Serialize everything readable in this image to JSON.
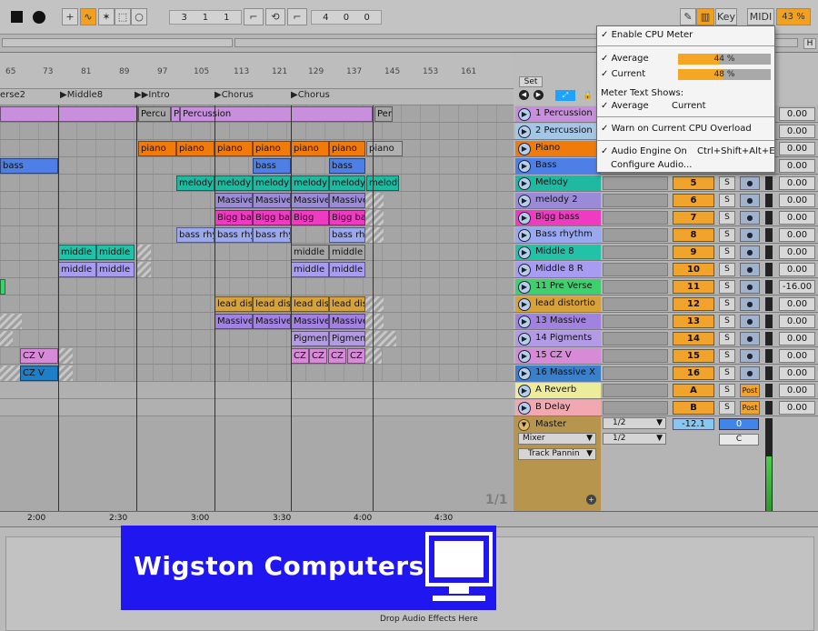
{
  "transport": {
    "position": [
      "3",
      "1",
      "1"
    ],
    "time": [
      "4",
      "0",
      "0"
    ]
  },
  "toolbar": {
    "key_label": "Key",
    "midi_label": "MIDI",
    "cpu_label": "43 %",
    "h_label": "H"
  },
  "ruler": {
    "bars": [
      "65",
      "73",
      "81",
      "89",
      "97",
      "105",
      "113",
      "121",
      "129",
      "137",
      "145",
      "153",
      "161"
    ],
    "times": [
      "2:00",
      "2:30",
      "3:00",
      "3:30",
      "4:00",
      "4:30"
    ]
  },
  "locators": [
    "erse2",
    "Middle8",
    "Intro",
    "Chorus",
    "Chorus"
  ],
  "set_label": "Set",
  "page_indicator": "1/1",
  "tracks": [
    {
      "name": "1 Percussion",
      "num": "",
      "vol": "0.00",
      "color": "#c890dc",
      "clips": [
        "Percu",
        "Percussion",
        "Per"
      ]
    },
    {
      "name": "2 Percussion",
      "num": "",
      "vol": "0.00",
      "color": "#a6c6e6",
      "clips": []
    },
    {
      "name": "Piano",
      "num": "",
      "vol": "0.00",
      "color": "#f07a0a",
      "clips": [
        "piano",
        "piano",
        "piano",
        "piano",
        "piano",
        "piano",
        "piano"
      ]
    },
    {
      "name": "Bass",
      "num": "",
      "vol": "0.00",
      "color": "#4d7fe6",
      "clips": [
        "bass",
        "bass",
        "bass"
      ]
    },
    {
      "name": "Melody",
      "num": "5",
      "vol": "0.00",
      "color": "#1fb8a0",
      "clips": [
        "melody",
        "melody",
        "melody",
        "melody",
        "melody",
        "melody"
      ]
    },
    {
      "name": "melody 2",
      "num": "6",
      "vol": "0.00",
      "color": "#9a8ad8",
      "clips": [
        "Massive",
        "Massive",
        "Massive",
        "Massive"
      ]
    },
    {
      "name": "Bigg bass",
      "num": "7",
      "vol": "0.00",
      "color": "#ee3bc2",
      "clips": [
        "Bigg bas",
        "Bigg bas",
        "Bigg bas"
      ]
    },
    {
      "name": "Bass rhythm",
      "num": "8",
      "vol": "0.00",
      "color": "#9aa8f0",
      "clips": [
        "bass rhy",
        "bass rhy",
        "bass rhy",
        "bass rhy"
      ]
    },
    {
      "name": "Middle 8",
      "num": "9",
      "vol": "0.00",
      "color": "#22c2a8",
      "clips": [
        "middle 8",
        "middle 8",
        "middle 8",
        "middle 8"
      ]
    },
    {
      "name": "Middle 8 R",
      "num": "10",
      "vol": "0.00",
      "color": "#a79cf2",
      "clips": [
        "middle 8",
        "middle 8",
        "middle 8",
        "middle 8"
      ]
    },
    {
      "name": "11 Pre Verse",
      "num": "11",
      "vol": "-16.00",
      "color": "#3fd06e",
      "clips": []
    },
    {
      "name": "lead distortio",
      "num": "12",
      "vol": "0.00",
      "color": "#d8a23a",
      "clips": [
        "lead dist",
        "lead dist",
        "lead dist",
        "lead dist"
      ]
    },
    {
      "name": "13 Massive",
      "num": "13",
      "vol": "0.00",
      "color": "#a182e0",
      "clips": [
        "Massive",
        "Massive",
        "Massive",
        "Massive"
      ]
    },
    {
      "name": "14 Pigments",
      "num": "14",
      "vol": "0.00",
      "color": "#b29ae4",
      "clips": [
        "Pigment",
        "Pigment"
      ]
    },
    {
      "name": "15 CZ V",
      "num": "15",
      "vol": "0.00",
      "color": "#d78ad8",
      "clips": [
        "CZ V",
        "CZ V",
        "CZ V",
        "CZ V",
        "CZ V"
      ]
    },
    {
      "name": "16 Massive X",
      "num": "16",
      "vol": "0.00",
      "color": "#3a7fc8",
      "clips": [
        "CZ V"
      ]
    }
  ],
  "returns": [
    {
      "name": "A Reverb",
      "num": "A",
      "post": "Post",
      "vol": "0.00"
    },
    {
      "name": "B Delay",
      "num": "B",
      "post": "Post",
      "vol": "0.00"
    }
  ],
  "master": {
    "name": "Master",
    "routing1": "1/2",
    "routing2": "1/2",
    "mixer_label": "Mixer",
    "panning_label": "Track Pannin",
    "level": "-12.1",
    "volume": "0",
    "pan": "C"
  },
  "cpu_menu": {
    "enable": "Enable CPU Meter",
    "average": "Average",
    "average_value": "44 %",
    "average_pct": 0.44,
    "current": "Current",
    "current_value": "48 %",
    "current_pct": 0.48,
    "meter_text_label": "Meter Text Shows:",
    "mt_average": "Average",
    "mt_current": "Current",
    "warn": "Warn on Current CPU Overload",
    "engine": "Audio Engine On",
    "engine_shortcut": "Ctrl+Shift+Alt+E",
    "configure": "Configure Audio..."
  },
  "detail": {
    "drop_text": "Drop Audio Effects Here"
  },
  "brand": {
    "name": "Wigston Computers"
  }
}
